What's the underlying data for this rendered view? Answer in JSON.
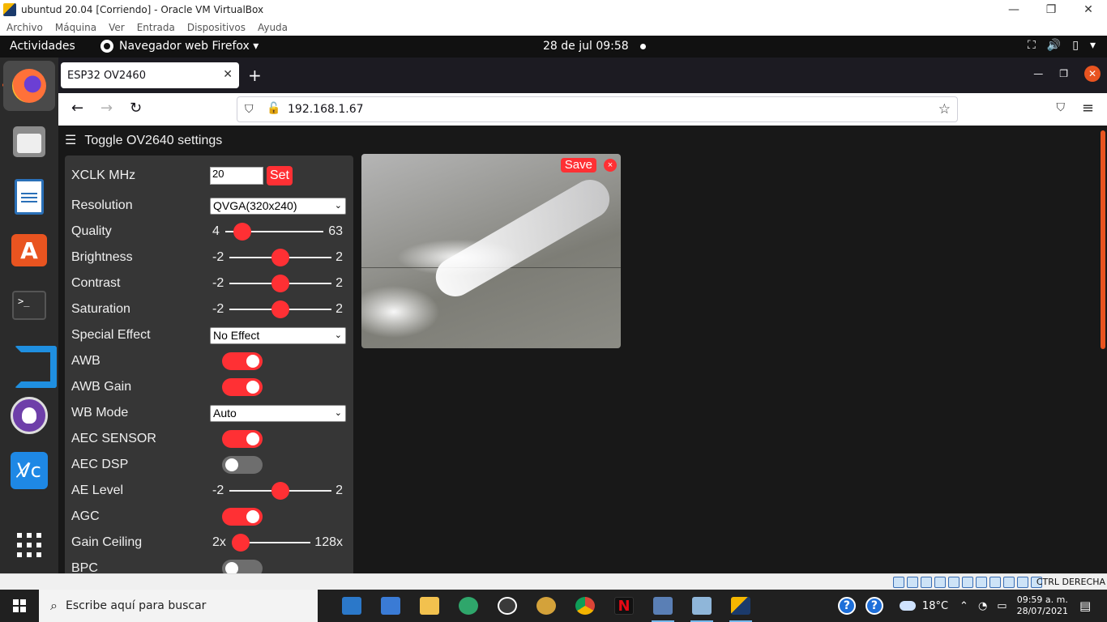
{
  "vbox": {
    "title": "ubuntud 20.04 [Corriendo] - Oracle VM VirtualBox",
    "menu": [
      "Archivo",
      "Máquina",
      "Ver",
      "Entrada",
      "Dispositivos",
      "Ayuda"
    ],
    "host_key": "CTRL DERECHA"
  },
  "gnome": {
    "activities": "Actividades",
    "app_menu": "Navegador web Firefox ▾",
    "clock": "28 de jul  09:58"
  },
  "dock": {
    "items": [
      "firefox-icon",
      "files-icon",
      "writer-icon",
      "software-icon",
      "terminal-icon",
      "vscode-icon",
      "github-icon",
      "vnc-icon",
      "show-apps-icon"
    ],
    "vnc_label": "V̸c"
  },
  "firefox": {
    "tab_title": "ESP32 OV2460",
    "url": "192.168.1.67"
  },
  "page": {
    "toggle_label": "Toggle OV2640 settings",
    "xclk": {
      "label": "XCLK MHz",
      "value": "20",
      "button": "Set"
    },
    "resolution": {
      "label": "Resolution",
      "value": "QVGA(320x240)"
    },
    "quality": {
      "label": "Quality",
      "min": "4",
      "max": "63",
      "value": 10
    },
    "brightness": {
      "label": "Brightness",
      "min": "-2",
      "max": "2",
      "value": 0
    },
    "contrast": {
      "label": "Contrast",
      "min": "-2",
      "max": "2",
      "value": 0
    },
    "saturation": {
      "label": "Saturation",
      "min": "-2",
      "max": "2",
      "value": 0
    },
    "special_effect": {
      "label": "Special Effect",
      "value": "No Effect"
    },
    "awb": {
      "label": "AWB",
      "on": true
    },
    "awb_gain": {
      "label": "AWB Gain",
      "on": true
    },
    "wb_mode": {
      "label": "WB Mode",
      "value": "Auto"
    },
    "aec_sensor": {
      "label": "AEC SENSOR",
      "on": true
    },
    "aec_dsp": {
      "label": "AEC DSP",
      "on": false
    },
    "ae_level": {
      "label": "AE Level",
      "min": "-2",
      "max": "2",
      "value": 0
    },
    "agc": {
      "label": "AGC",
      "on": true
    },
    "gain_ceiling": {
      "label": "Gain Ceiling",
      "min": "2x",
      "max": "128x",
      "value": 0
    },
    "bpc": {
      "label": "BPC",
      "on": false
    },
    "stream": {
      "save": "Save",
      "close": "×"
    }
  },
  "taskbar": {
    "search_placeholder": "Escribe aquí para buscar",
    "weather": "18°C",
    "time": "09:59 a. m.",
    "date": "28/07/2021"
  },
  "colors": {
    "accent": "#ff3034",
    "panel": "#363636",
    "ubuntu_orange": "#e95420"
  }
}
